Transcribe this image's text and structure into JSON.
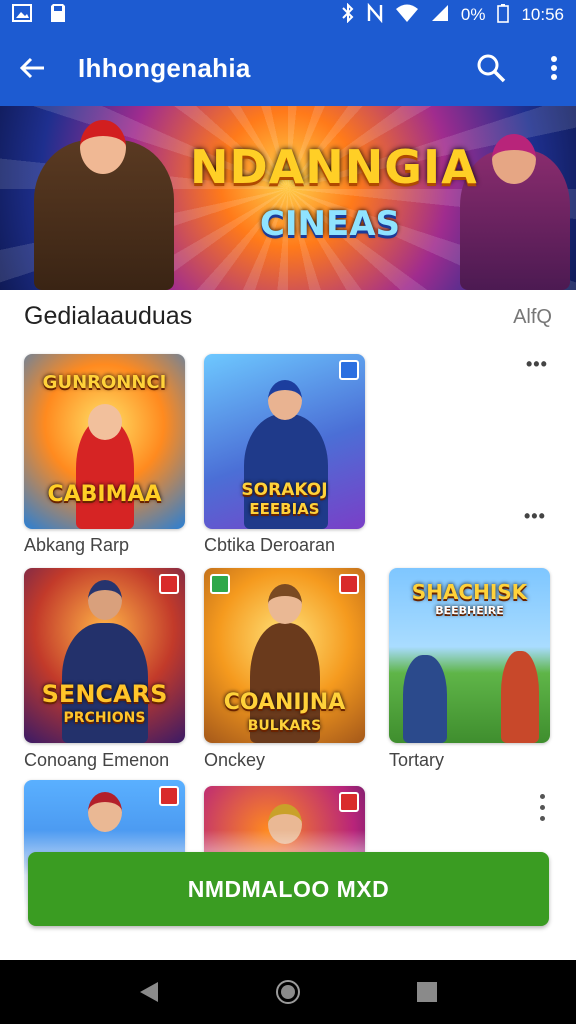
{
  "status_bar": {
    "battery": "0%",
    "time": "10:56",
    "icons": [
      "gallery-icon",
      "sd-card-icon",
      "bluetooth-icon",
      "nfc-icon",
      "wifi-icon",
      "signal-icon"
    ]
  },
  "app_bar": {
    "title": "Ihhongenahia",
    "back_icon": "arrow-left-icon",
    "search_icon": "search-icon",
    "menu_icon": "more-vert-icon"
  },
  "banner": {
    "title_line1": "NDANNGIA",
    "title_line2": "CINEAS"
  },
  "section": {
    "title": "Gedialaauduas",
    "link": "AlfQ"
  },
  "games": [
    {
      "art_title": "GUNRONNCI",
      "art_subtitle": "CABIMAA",
      "caption": "Abkang Rarp"
    },
    {
      "art_title": "SORAKOJ",
      "art_subtitle": "EEEBIAS",
      "caption": "Cbtika Deroaran"
    },
    {
      "art_title": "SENCARS",
      "art_subtitle": "PRCHIONS",
      "caption": "Conoang Emenon"
    },
    {
      "art_title": "COANIJNA",
      "art_subtitle": "BULKARS",
      "caption": "Onckey"
    },
    {
      "art_title": "SHACHISK",
      "art_subtitle": "BEEBHEIRE",
      "caption": "Tortary"
    },
    {
      "art_title": "",
      "art_subtitle": "",
      "caption": ""
    },
    {
      "art_title": "",
      "art_subtitle": "",
      "caption": ""
    }
  ],
  "install_button": {
    "label": "NMDMALOO MXD"
  },
  "colors": {
    "primary": "#1d5bd1",
    "install": "#3a9c22",
    "navbar": "#000000"
  },
  "nav_bar": {
    "icons": [
      "back-triangle-icon",
      "home-circle-icon",
      "recents-square-icon"
    ]
  }
}
